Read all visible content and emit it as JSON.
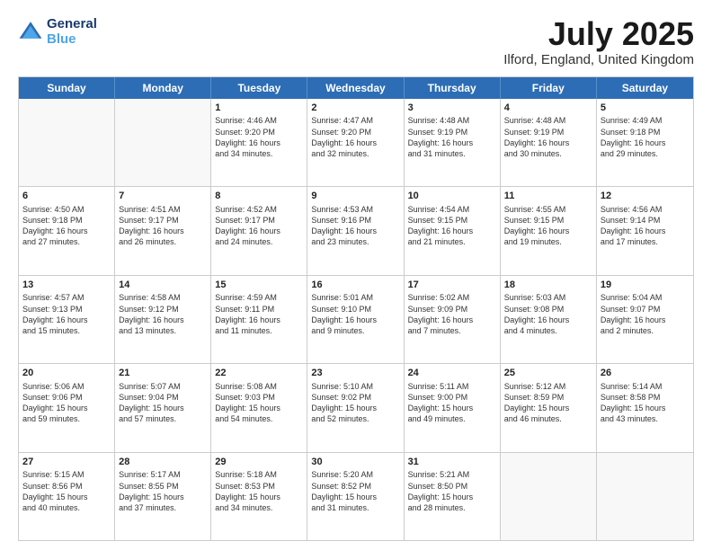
{
  "header": {
    "logo_line1": "General",
    "logo_line2": "Blue",
    "month_title": "July 2025",
    "location": "Ilford, England, United Kingdom"
  },
  "days_of_week": [
    "Sunday",
    "Monday",
    "Tuesday",
    "Wednesday",
    "Thursday",
    "Friday",
    "Saturday"
  ],
  "weeks": [
    [
      {
        "day": "",
        "info": "",
        "empty": true
      },
      {
        "day": "",
        "info": "",
        "empty": true
      },
      {
        "day": "1",
        "info": "Sunrise: 4:46 AM\nSunset: 9:20 PM\nDaylight: 16 hours\nand 34 minutes.",
        "empty": false
      },
      {
        "day": "2",
        "info": "Sunrise: 4:47 AM\nSunset: 9:20 PM\nDaylight: 16 hours\nand 32 minutes.",
        "empty": false
      },
      {
        "day": "3",
        "info": "Sunrise: 4:48 AM\nSunset: 9:19 PM\nDaylight: 16 hours\nand 31 minutes.",
        "empty": false
      },
      {
        "day": "4",
        "info": "Sunrise: 4:48 AM\nSunset: 9:19 PM\nDaylight: 16 hours\nand 30 minutes.",
        "empty": false
      },
      {
        "day": "5",
        "info": "Sunrise: 4:49 AM\nSunset: 9:18 PM\nDaylight: 16 hours\nand 29 minutes.",
        "empty": false
      }
    ],
    [
      {
        "day": "6",
        "info": "Sunrise: 4:50 AM\nSunset: 9:18 PM\nDaylight: 16 hours\nand 27 minutes.",
        "empty": false
      },
      {
        "day": "7",
        "info": "Sunrise: 4:51 AM\nSunset: 9:17 PM\nDaylight: 16 hours\nand 26 minutes.",
        "empty": false
      },
      {
        "day": "8",
        "info": "Sunrise: 4:52 AM\nSunset: 9:17 PM\nDaylight: 16 hours\nand 24 minutes.",
        "empty": false
      },
      {
        "day": "9",
        "info": "Sunrise: 4:53 AM\nSunset: 9:16 PM\nDaylight: 16 hours\nand 23 minutes.",
        "empty": false
      },
      {
        "day": "10",
        "info": "Sunrise: 4:54 AM\nSunset: 9:15 PM\nDaylight: 16 hours\nand 21 minutes.",
        "empty": false
      },
      {
        "day": "11",
        "info": "Sunrise: 4:55 AM\nSunset: 9:15 PM\nDaylight: 16 hours\nand 19 minutes.",
        "empty": false
      },
      {
        "day": "12",
        "info": "Sunrise: 4:56 AM\nSunset: 9:14 PM\nDaylight: 16 hours\nand 17 minutes.",
        "empty": false
      }
    ],
    [
      {
        "day": "13",
        "info": "Sunrise: 4:57 AM\nSunset: 9:13 PM\nDaylight: 16 hours\nand 15 minutes.",
        "empty": false
      },
      {
        "day": "14",
        "info": "Sunrise: 4:58 AM\nSunset: 9:12 PM\nDaylight: 16 hours\nand 13 minutes.",
        "empty": false
      },
      {
        "day": "15",
        "info": "Sunrise: 4:59 AM\nSunset: 9:11 PM\nDaylight: 16 hours\nand 11 minutes.",
        "empty": false
      },
      {
        "day": "16",
        "info": "Sunrise: 5:01 AM\nSunset: 9:10 PM\nDaylight: 16 hours\nand 9 minutes.",
        "empty": false
      },
      {
        "day": "17",
        "info": "Sunrise: 5:02 AM\nSunset: 9:09 PM\nDaylight: 16 hours\nand 7 minutes.",
        "empty": false
      },
      {
        "day": "18",
        "info": "Sunrise: 5:03 AM\nSunset: 9:08 PM\nDaylight: 16 hours\nand 4 minutes.",
        "empty": false
      },
      {
        "day": "19",
        "info": "Sunrise: 5:04 AM\nSunset: 9:07 PM\nDaylight: 16 hours\nand 2 minutes.",
        "empty": false
      }
    ],
    [
      {
        "day": "20",
        "info": "Sunrise: 5:06 AM\nSunset: 9:06 PM\nDaylight: 15 hours\nand 59 minutes.",
        "empty": false
      },
      {
        "day": "21",
        "info": "Sunrise: 5:07 AM\nSunset: 9:04 PM\nDaylight: 15 hours\nand 57 minutes.",
        "empty": false
      },
      {
        "day": "22",
        "info": "Sunrise: 5:08 AM\nSunset: 9:03 PM\nDaylight: 15 hours\nand 54 minutes.",
        "empty": false
      },
      {
        "day": "23",
        "info": "Sunrise: 5:10 AM\nSunset: 9:02 PM\nDaylight: 15 hours\nand 52 minutes.",
        "empty": false
      },
      {
        "day": "24",
        "info": "Sunrise: 5:11 AM\nSunset: 9:00 PM\nDaylight: 15 hours\nand 49 minutes.",
        "empty": false
      },
      {
        "day": "25",
        "info": "Sunrise: 5:12 AM\nSunset: 8:59 PM\nDaylight: 15 hours\nand 46 minutes.",
        "empty": false
      },
      {
        "day": "26",
        "info": "Sunrise: 5:14 AM\nSunset: 8:58 PM\nDaylight: 15 hours\nand 43 minutes.",
        "empty": false
      }
    ],
    [
      {
        "day": "27",
        "info": "Sunrise: 5:15 AM\nSunset: 8:56 PM\nDaylight: 15 hours\nand 40 minutes.",
        "empty": false
      },
      {
        "day": "28",
        "info": "Sunrise: 5:17 AM\nSunset: 8:55 PM\nDaylight: 15 hours\nand 37 minutes.",
        "empty": false
      },
      {
        "day": "29",
        "info": "Sunrise: 5:18 AM\nSunset: 8:53 PM\nDaylight: 15 hours\nand 34 minutes.",
        "empty": false
      },
      {
        "day": "30",
        "info": "Sunrise: 5:20 AM\nSunset: 8:52 PM\nDaylight: 15 hours\nand 31 minutes.",
        "empty": false
      },
      {
        "day": "31",
        "info": "Sunrise: 5:21 AM\nSunset: 8:50 PM\nDaylight: 15 hours\nand 28 minutes.",
        "empty": false
      },
      {
        "day": "",
        "info": "",
        "empty": true
      },
      {
        "day": "",
        "info": "",
        "empty": true
      }
    ]
  ]
}
